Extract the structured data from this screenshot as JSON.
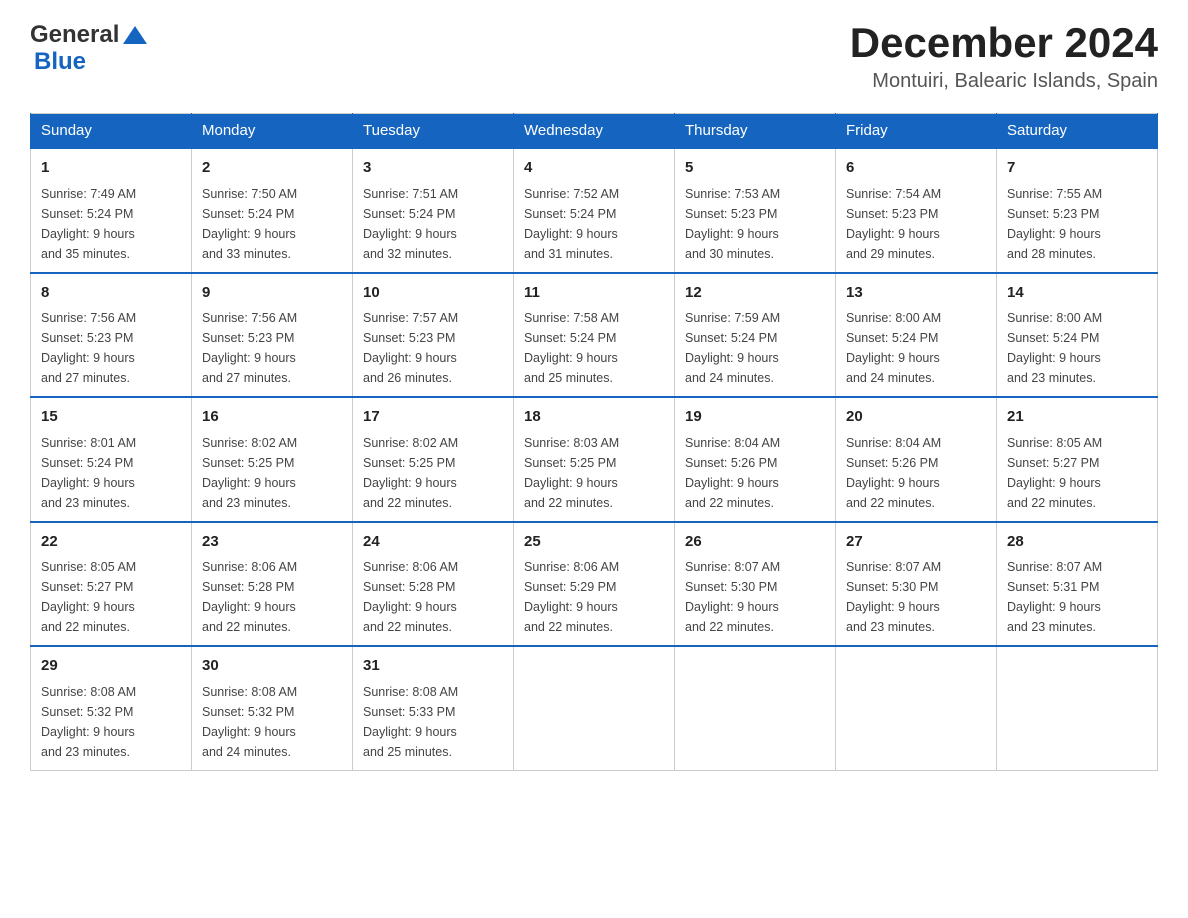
{
  "header": {
    "logo_general": "General",
    "logo_blue": "Blue",
    "month_title": "December 2024",
    "location": "Montuiri, Balearic Islands, Spain"
  },
  "days_of_week": [
    "Sunday",
    "Monday",
    "Tuesday",
    "Wednesday",
    "Thursday",
    "Friday",
    "Saturday"
  ],
  "weeks": [
    [
      {
        "day": "1",
        "sunrise": "7:49 AM",
        "sunset": "5:24 PM",
        "daylight": "9 hours and 35 minutes."
      },
      {
        "day": "2",
        "sunrise": "7:50 AM",
        "sunset": "5:24 PM",
        "daylight": "9 hours and 33 minutes."
      },
      {
        "day": "3",
        "sunrise": "7:51 AM",
        "sunset": "5:24 PM",
        "daylight": "9 hours and 32 minutes."
      },
      {
        "day": "4",
        "sunrise": "7:52 AM",
        "sunset": "5:24 PM",
        "daylight": "9 hours and 31 minutes."
      },
      {
        "day": "5",
        "sunrise": "7:53 AM",
        "sunset": "5:23 PM",
        "daylight": "9 hours and 30 minutes."
      },
      {
        "day": "6",
        "sunrise": "7:54 AM",
        "sunset": "5:23 PM",
        "daylight": "9 hours and 29 minutes."
      },
      {
        "day": "7",
        "sunrise": "7:55 AM",
        "sunset": "5:23 PM",
        "daylight": "9 hours and 28 minutes."
      }
    ],
    [
      {
        "day": "8",
        "sunrise": "7:56 AM",
        "sunset": "5:23 PM",
        "daylight": "9 hours and 27 minutes."
      },
      {
        "day": "9",
        "sunrise": "7:56 AM",
        "sunset": "5:23 PM",
        "daylight": "9 hours and 27 minutes."
      },
      {
        "day": "10",
        "sunrise": "7:57 AM",
        "sunset": "5:23 PM",
        "daylight": "9 hours and 26 minutes."
      },
      {
        "day": "11",
        "sunrise": "7:58 AM",
        "sunset": "5:24 PM",
        "daylight": "9 hours and 25 minutes."
      },
      {
        "day": "12",
        "sunrise": "7:59 AM",
        "sunset": "5:24 PM",
        "daylight": "9 hours and 24 minutes."
      },
      {
        "day": "13",
        "sunrise": "8:00 AM",
        "sunset": "5:24 PM",
        "daylight": "9 hours and 24 minutes."
      },
      {
        "day": "14",
        "sunrise": "8:00 AM",
        "sunset": "5:24 PM",
        "daylight": "9 hours and 23 minutes."
      }
    ],
    [
      {
        "day": "15",
        "sunrise": "8:01 AM",
        "sunset": "5:24 PM",
        "daylight": "9 hours and 23 minutes."
      },
      {
        "day": "16",
        "sunrise": "8:02 AM",
        "sunset": "5:25 PM",
        "daylight": "9 hours and 23 minutes."
      },
      {
        "day": "17",
        "sunrise": "8:02 AM",
        "sunset": "5:25 PM",
        "daylight": "9 hours and 22 minutes."
      },
      {
        "day": "18",
        "sunrise": "8:03 AM",
        "sunset": "5:25 PM",
        "daylight": "9 hours and 22 minutes."
      },
      {
        "day": "19",
        "sunrise": "8:04 AM",
        "sunset": "5:26 PM",
        "daylight": "9 hours and 22 minutes."
      },
      {
        "day": "20",
        "sunrise": "8:04 AM",
        "sunset": "5:26 PM",
        "daylight": "9 hours and 22 minutes."
      },
      {
        "day": "21",
        "sunrise": "8:05 AM",
        "sunset": "5:27 PM",
        "daylight": "9 hours and 22 minutes."
      }
    ],
    [
      {
        "day": "22",
        "sunrise": "8:05 AM",
        "sunset": "5:27 PM",
        "daylight": "9 hours and 22 minutes."
      },
      {
        "day": "23",
        "sunrise": "8:06 AM",
        "sunset": "5:28 PM",
        "daylight": "9 hours and 22 minutes."
      },
      {
        "day": "24",
        "sunrise": "8:06 AM",
        "sunset": "5:28 PM",
        "daylight": "9 hours and 22 minutes."
      },
      {
        "day": "25",
        "sunrise": "8:06 AM",
        "sunset": "5:29 PM",
        "daylight": "9 hours and 22 minutes."
      },
      {
        "day": "26",
        "sunrise": "8:07 AM",
        "sunset": "5:30 PM",
        "daylight": "9 hours and 22 minutes."
      },
      {
        "day": "27",
        "sunrise": "8:07 AM",
        "sunset": "5:30 PM",
        "daylight": "9 hours and 23 minutes."
      },
      {
        "day": "28",
        "sunrise": "8:07 AM",
        "sunset": "5:31 PM",
        "daylight": "9 hours and 23 minutes."
      }
    ],
    [
      {
        "day": "29",
        "sunrise": "8:08 AM",
        "sunset": "5:32 PM",
        "daylight": "9 hours and 23 minutes."
      },
      {
        "day": "30",
        "sunrise": "8:08 AM",
        "sunset": "5:32 PM",
        "daylight": "9 hours and 24 minutes."
      },
      {
        "day": "31",
        "sunrise": "8:08 AM",
        "sunset": "5:33 PM",
        "daylight": "9 hours and 25 minutes."
      },
      null,
      null,
      null,
      null
    ]
  ],
  "labels": {
    "sunrise": "Sunrise:",
    "sunset": "Sunset:",
    "daylight": "Daylight:"
  }
}
